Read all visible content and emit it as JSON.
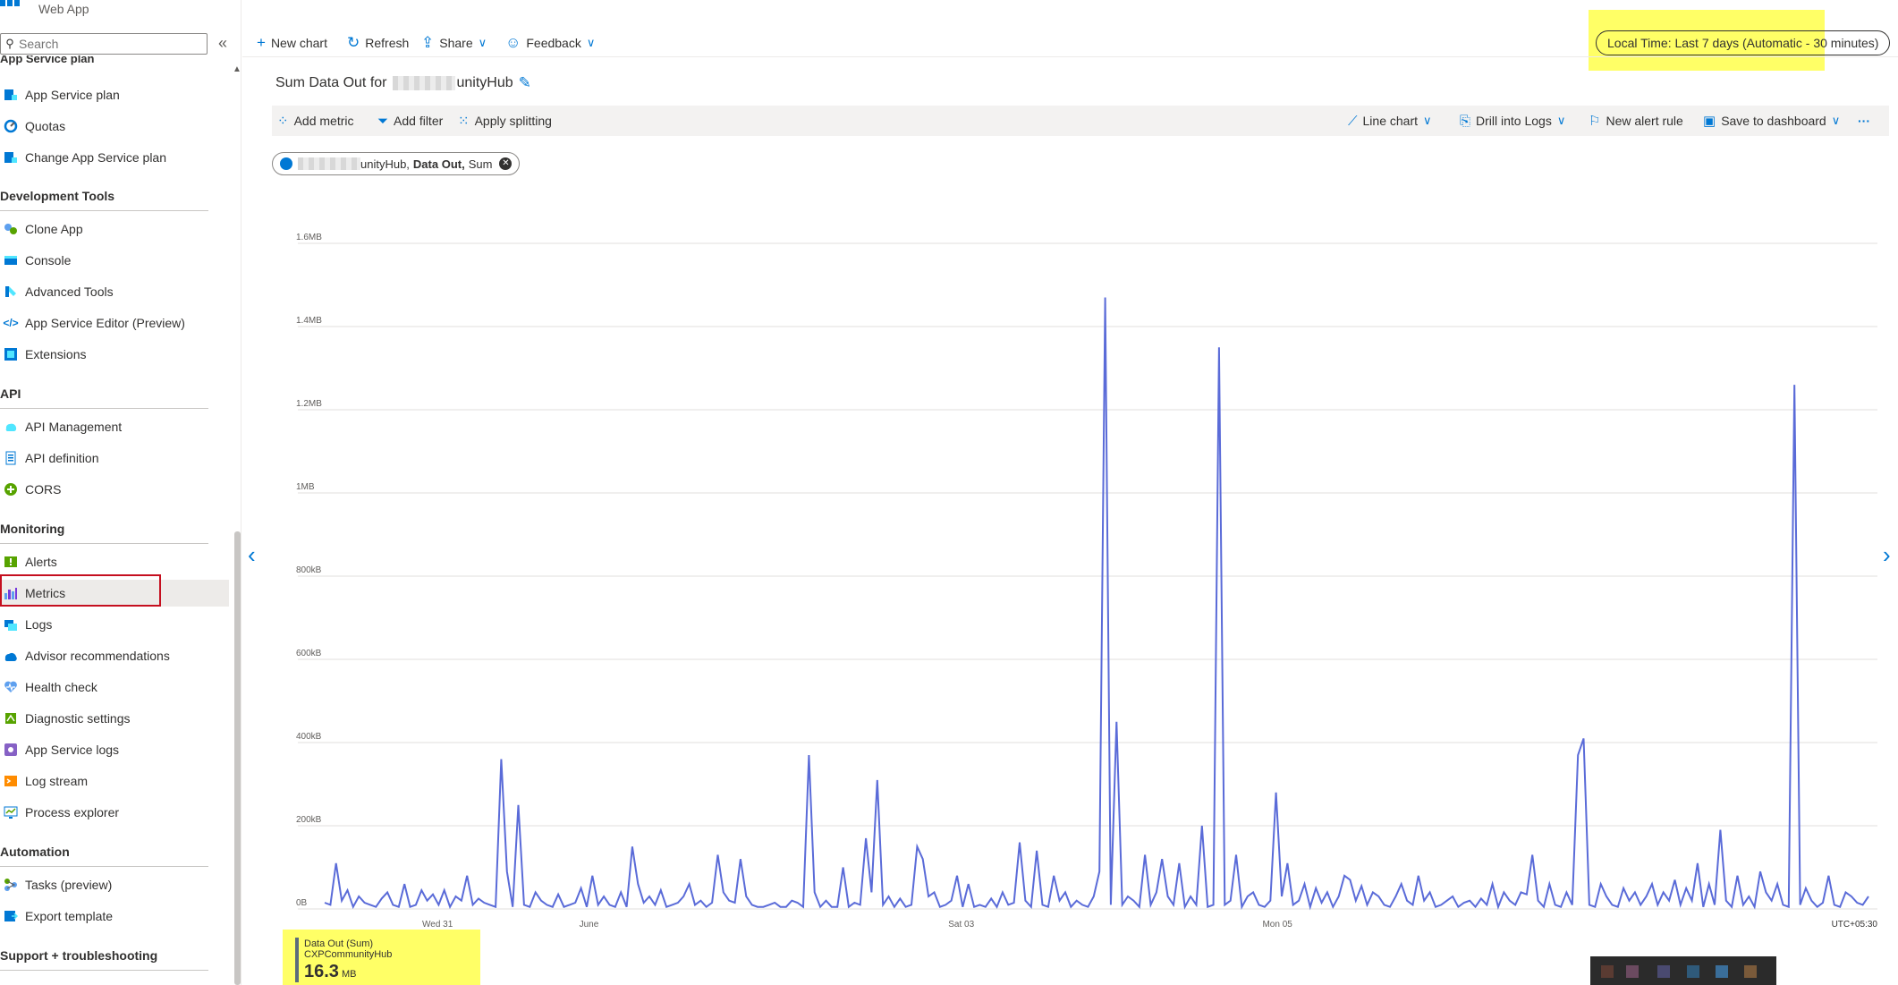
{
  "app": {
    "name": "Web App"
  },
  "search": {
    "placeholder": "Search"
  },
  "sidebar": {
    "cut_header": "App Service plan",
    "items": [
      {
        "label": "App Service plan"
      },
      {
        "label": "Quotas"
      },
      {
        "label": "Change App Service plan"
      },
      {
        "label": "Clone App"
      },
      {
        "label": "Console"
      },
      {
        "label": "Advanced Tools"
      },
      {
        "label": "App Service Editor (Preview)"
      },
      {
        "label": "Extensions"
      },
      {
        "label": "API Management"
      },
      {
        "label": "API definition"
      },
      {
        "label": "CORS"
      },
      {
        "label": "Alerts"
      },
      {
        "label": "Metrics"
      },
      {
        "label": "Logs"
      },
      {
        "label": "Advisor recommendations"
      },
      {
        "label": "Health check"
      },
      {
        "label": "Diagnostic settings"
      },
      {
        "label": "App Service logs"
      },
      {
        "label": "Log stream"
      },
      {
        "label": "Process explorer"
      },
      {
        "label": "Tasks (preview)"
      },
      {
        "label": "Export template"
      }
    ],
    "sections": {
      "dev_tools": "Development Tools",
      "api": "API",
      "monitoring": "Monitoring",
      "automation": "Automation",
      "support": "Support + troubleshooting"
    }
  },
  "toolbar": {
    "new_chart": "New chart",
    "refresh": "Refresh",
    "share": "Share",
    "feedback": "Feedback",
    "time_range": "Local Time: Last 7 days (Automatic - 30 minutes)"
  },
  "chart_header": {
    "title_prefix": "Sum Data Out for",
    "title_suffix": "unityHub"
  },
  "metric_bar": {
    "add_metric": "Add metric",
    "add_filter": "Add filter",
    "apply_splitting": "Apply splitting",
    "line_chart": "Line chart",
    "drill_logs": "Drill into Logs",
    "new_alert": "New alert rule",
    "save_dashboard": "Save to dashboard",
    "more": "···"
  },
  "metric_pill": {
    "resource": "unityHub,",
    "metric": "Data Out,",
    "aggregation": "Sum"
  },
  "legend": {
    "metric": "Data Out (Sum)",
    "resource": "CXPCommunityHub",
    "value": "16.3",
    "unit": "MB"
  },
  "colors": {
    "accent": "#0078d4",
    "series": "#5a6bd8",
    "highlight": "#ffff66"
  },
  "chart_data": {
    "type": "line",
    "y_unit": "kB",
    "ylim": [
      0,
      1600
    ],
    "y_ticks": [
      "0B",
      "200kB",
      "400kB",
      "600kB",
      "800kB",
      "1MB",
      "1.2MB",
      "1.4MB",
      "1.6MB"
    ],
    "x_ticks": [
      "Wed 31",
      "June",
      "Sat 03",
      "Mon 05"
    ],
    "timezone": "UTC+05:30",
    "series": [
      {
        "values": [
          15,
          10,
          110,
          20,
          45,
          5,
          30,
          15,
          10,
          5,
          25,
          40,
          10,
          5,
          60,
          5,
          10,
          45,
          20,
          35,
          10,
          45,
          5,
          30,
          20,
          80,
          10,
          25,
          15,
          10,
          5,
          360,
          90,
          5,
          250,
          10,
          5,
          40,
          20,
          10,
          5,
          35,
          5,
          10,
          15,
          50,
          5,
          80,
          10,
          30,
          10,
          5,
          40,
          5,
          150,
          60,
          15,
          30,
          10,
          45,
          5,
          10,
          15,
          30,
          60,
          10,
          20,
          5,
          15,
          130,
          40,
          20,
          15,
          120,
          30,
          10,
          5,
          5,
          10,
          15,
          5,
          5,
          20,
          15,
          5,
          370,
          40,
          5,
          20,
          5,
          5,
          100,
          5,
          15,
          10,
          170,
          40,
          310,
          10,
          30,
          5,
          25,
          5,
          10,
          150,
          120,
          30,
          40,
          5,
          10,
          20,
          80,
          5,
          60,
          5,
          10,
          5,
          25,
          5,
          40,
          10,
          15,
          160,
          20,
          5,
          140,
          10,
          5,
          80,
          20,
          40,
          5,
          20,
          10,
          5,
          30,
          90,
          1470,
          10,
          450,
          10,
          30,
          20,
          5,
          130,
          10,
          40,
          120,
          30,
          10,
          110,
          5,
          30,
          10,
          200,
          5,
          10,
          1350,
          10,
          20,
          130,
          5,
          30,
          40,
          10,
          5,
          20,
          280,
          30,
          110,
          10,
          20,
          60,
          5,
          50,
          15,
          40,
          5,
          30,
          80,
          70,
          20,
          55,
          10,
          40,
          30,
          10,
          5,
          30,
          60,
          20,
          10,
          80,
          20,
          40,
          5,
          10,
          20,
          30,
          5,
          15,
          20,
          5,
          25,
          10,
          60,
          5,
          40,
          20,
          10,
          40,
          35,
          130,
          20,
          5,
          60,
          10,
          5,
          40,
          10,
          370,
          410,
          10,
          5,
          60,
          30,
          10,
          5,
          50,
          20,
          40,
          10,
          30,
          60,
          10,
          40,
          20,
          70,
          10,
          50,
          20,
          110,
          5,
          60,
          10,
          190,
          20,
          5,
          80,
          10,
          30,
          5,
          90,
          40,
          20,
          60,
          10,
          5,
          1260,
          10,
          50,
          20,
          5,
          15,
          80,
          10,
          5,
          40,
          30,
          15,
          10,
          30
        ]
      }
    ]
  }
}
